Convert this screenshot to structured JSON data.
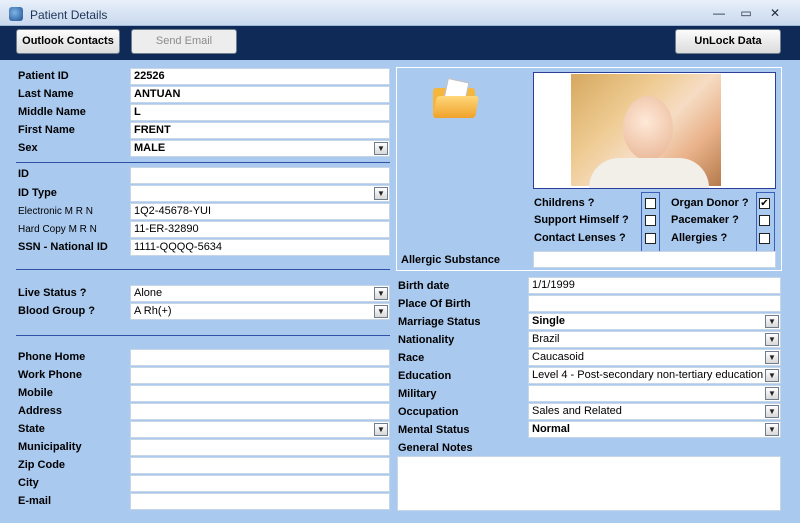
{
  "window": {
    "title": "Patient Details",
    "minimize": "—",
    "maximize": "▭",
    "close": "✕"
  },
  "toolbar": {
    "outlook": "Outlook Contacts",
    "send_email": "Send Email",
    "unlock": "UnLock Data"
  },
  "patient": {
    "id_label": "Patient ID",
    "id": "22526",
    "last_label": "Last Name",
    "last": "ANTUAN",
    "middle_label": "Middle Name",
    "middle": "L",
    "first_label": "First Name",
    "first": "FRENT",
    "sex_label": "Sex",
    "sex": "MALE"
  },
  "ids": {
    "id_label": "ID",
    "id": "",
    "type_label": "ID Type",
    "type": "",
    "emrn_label": "Electronic M R N",
    "emrn": "1Q2-45678-YUI",
    "hcmrn_label": "Hard Copy M R N",
    "hcmrn": "11-ER-32890",
    "ssn_label": "SSN - National ID",
    "ssn": "1111-QQQQ-5634"
  },
  "status": {
    "live_label": "Live Status ?",
    "live": "Alone",
    "blood_label": "Blood Group ?",
    "blood": "A Rh(+)"
  },
  "contact": {
    "phone_home": "Phone Home",
    "work_phone": "Work Phone",
    "mobile": "Mobile",
    "address": "Address",
    "state": "State",
    "municipality": "Municipality",
    "zip": "Zip Code",
    "city": "City",
    "email": "E-mail"
  },
  "flags": {
    "childrens": "Childrens ?",
    "childrens_checked": false,
    "support": "Support Himself ?",
    "support_checked": false,
    "lenses": "Contact Lenses ?",
    "lenses_checked": false,
    "organ": "Organ Donor ?",
    "organ_checked": true,
    "pacemaker": "Pacemaker ?",
    "pacemaker_checked": false,
    "allergies": "Allergies ?",
    "allergies_checked": false,
    "check_mark": "✔",
    "allergic_label": "Allergic  Substance",
    "allergic": ""
  },
  "demographics": {
    "birth_label": "Birth date",
    "birth": "1/1/1999",
    "place_label": "Place Of Birth",
    "place": "",
    "marriage_label": "Marriage Status",
    "marriage": "Single",
    "nationality_label": "Nationality",
    "nationality": "Brazil",
    "race_label": "Race",
    "race": "Caucasoid",
    "education_label": "Education",
    "education": "Level 4 - Post-secondary non-tertiary education",
    "military_label": "Military",
    "military": "",
    "occupation_label": "Occupation",
    "occupation": "Sales and Related",
    "mental_label": "Mental Status",
    "mental": "Normal",
    "notes_label": "General Notes"
  },
  "dropdown_glyph": "▼"
}
